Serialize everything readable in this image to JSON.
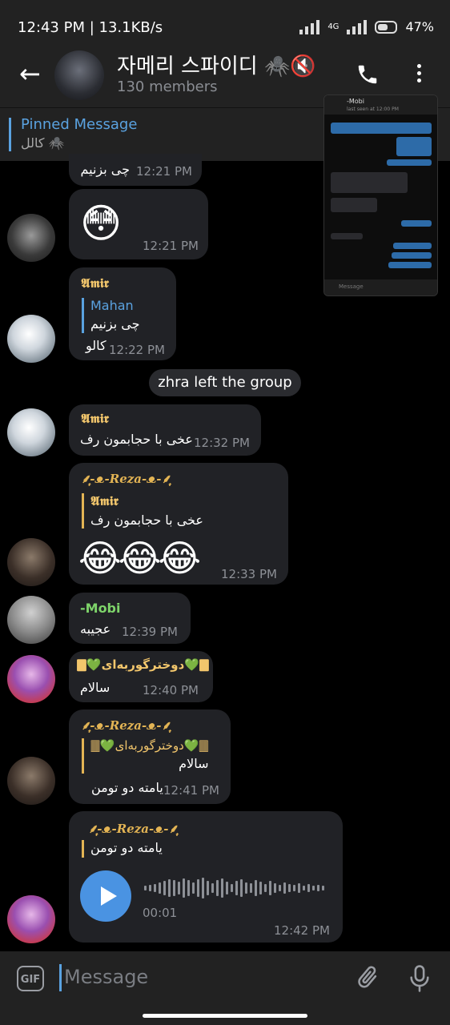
{
  "status_bar": {
    "time_speed": "12:43 PM | 13.1KB/s",
    "net": "4G",
    "battery": "47%"
  },
  "header": {
    "title": "자메리 스파이디 🕷️🔇",
    "members": "130 members"
  },
  "pinned": {
    "label": "Pinned Message",
    "text": "كالل 🕷️"
  },
  "thumbnail": {
    "chat_name": "-Mobi",
    "status": "last seen at 12:00 PM",
    "input_placeholder": "Message"
  },
  "messages": [
    {
      "text": "چی بزنیم",
      "time": "12:21 PM"
    },
    {
      "emoji": "😳",
      "time": "12:21 PM"
    },
    {
      "sender": "𝕬𝖒𝖎𝖗",
      "reply_to": "Mahan",
      "reply_text": "چی بزنیم",
      "text": "کالو",
      "time": "12:22 PM"
    },
    {
      "system": "zhra left the group"
    },
    {
      "sender": "𝕬𝖒𝖎𝖗",
      "text": "عخی با حجابمون رف",
      "time": "12:32 PM"
    },
    {
      "sender": "⸙͎-ᴥ-𝑹𝒆𝒛𝒂-ᴥ-⸙͎",
      "reply_to": "𝕬𝖒𝖎𝖗",
      "reply_text": "عخی با حجابمون رف",
      "text": "😂😂😂",
      "time": "12:33 PM"
    },
    {
      "sender": "-Mobi",
      "text": "عجیبه",
      "time": "12:39 PM"
    },
    {
      "sender": "🀫💚دوخترگوربه‌ای💚🀫",
      "text": "سالام",
      "time": "12:40 PM"
    },
    {
      "sender": "⸙͎-ᴥ-𝑹𝒆𝒛𝒂-ᴥ-⸙͎",
      "reply_to": "🀫💚دوخترگوربه‌ای💚🀫",
      "reply_text": "سالام",
      "text": "یامته دو تومن",
      "time": "12:41 PM"
    },
    {
      "sender": "⸙͎-ᴥ-𝑹𝒆𝒛𝒂-ᴥ-⸙͎",
      "reply_text": "یامته دو تومن",
      "voice_duration": "00:01",
      "time": "12:42 PM"
    }
  ],
  "input": {
    "gif": "GIF",
    "placeholder": "Message"
  },
  "colors": {
    "accent": "#5aa2e0",
    "bubble": "#212226",
    "amir": "#f2c66c",
    "reza": "#e3b454",
    "mobi": "#7ed46a",
    "play": "#4a93e2"
  }
}
